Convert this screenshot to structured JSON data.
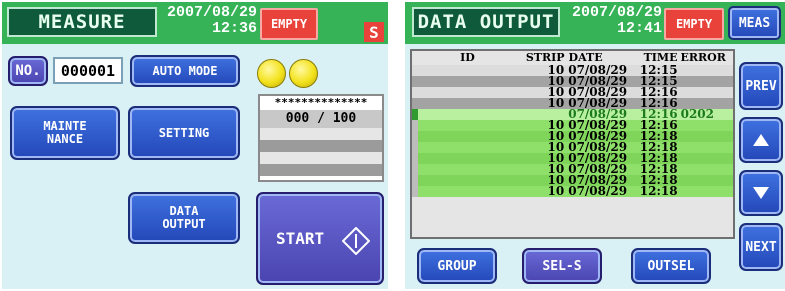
{
  "measure_screen": {
    "title": "MEASURE",
    "date": "2007/08/29",
    "time": "12:36",
    "empty_label": "EMPTY",
    "status_letter": "S",
    "no_label": "NO.",
    "number_value": "000001",
    "auto_mode_label": "AUTO MODE",
    "mainte_label": "MAINTE\n NANCE",
    "setting_label": "SETTING",
    "data_output_label": "DATA\n  OUTPUT",
    "start_label": "START",
    "counter_stars": "**************",
    "counter_value": "000 / 100",
    "lamp_color": "#f3e21c"
  },
  "data_output_screen": {
    "title": "DATA OUTPUT",
    "date": "2007/08/29",
    "time": "12:41",
    "empty_label": "EMPTY",
    "meas_label": "MEAS",
    "prev_label": "PREV",
    "next_label": "NEXT",
    "up_icon": "triangle-up-icon",
    "down_icon": "triangle-down-icon",
    "group_label": "GROUP",
    "sel_s_label": "SEL-S",
    "outsel_label": "OUTSEL",
    "columns": [
      "ID",
      "STRIP",
      "DATE",
      "TIME",
      "ERROR"
    ],
    "rows": [
      {
        "id": "",
        "strip": "10",
        "date": "07/08/29",
        "time": "12:15",
        "error": ""
      },
      {
        "id": "",
        "strip": "10",
        "date": "07/08/29",
        "time": "12:15",
        "error": ""
      },
      {
        "id": "",
        "strip": "10",
        "date": "07/08/29",
        "time": "12:16",
        "error": ""
      },
      {
        "id": "",
        "strip": "10",
        "date": "07/08/29",
        "time": "12:16",
        "error": ""
      },
      {
        "id": "",
        "strip": "",
        "date": "07/08/29",
        "time": "12:16",
        "error": "0202"
      },
      {
        "id": "",
        "strip": "10",
        "date": "07/08/29",
        "time": "12:16",
        "error": ""
      },
      {
        "id": "",
        "strip": "10",
        "date": "07/08/29",
        "time": "12:18",
        "error": ""
      },
      {
        "id": "",
        "strip": "10",
        "date": "07/08/29",
        "time": "12:18",
        "error": ""
      },
      {
        "id": "",
        "strip": "10",
        "date": "07/08/29",
        "time": "12:18",
        "error": ""
      },
      {
        "id": "",
        "strip": "10",
        "date": "07/08/29",
        "time": "12:18",
        "error": ""
      },
      {
        "id": "",
        "strip": "10",
        "date": "07/08/29",
        "time": "12:18",
        "error": ""
      },
      {
        "id": "",
        "strip": "10",
        "date": "07/08/29",
        "time": "12:18",
        "error": ""
      }
    ],
    "colors": {
      "accent_green": "#36b357",
      "row_green": "#8fe06b",
      "row_gray": "#a3a3a3",
      "button_blue": "#2f5ad0",
      "empty_red": "#e8423a"
    }
  }
}
